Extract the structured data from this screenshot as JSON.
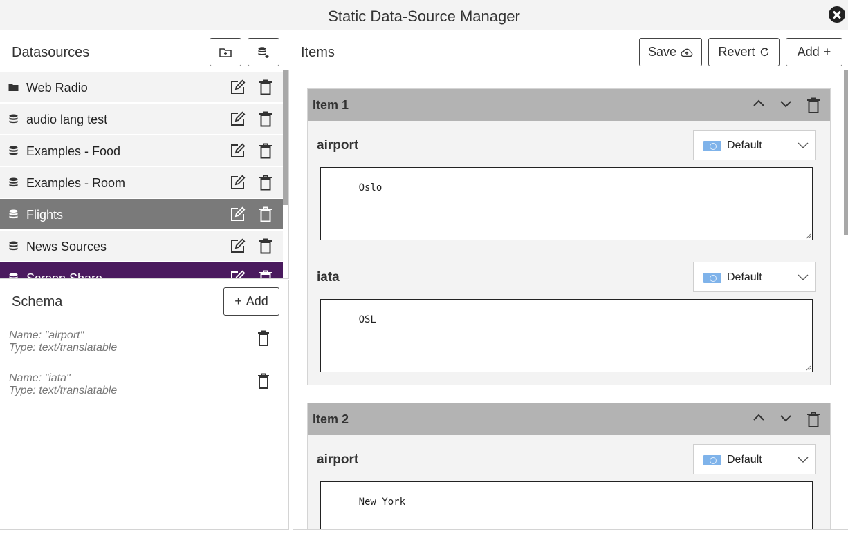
{
  "window": {
    "title": "Static Data-Source Manager"
  },
  "datasources": {
    "title": "Datasources",
    "items": [
      {
        "label": "Web Radio",
        "icon": "folder-icon",
        "state": "normal"
      },
      {
        "label": "audio lang test",
        "icon": "database-icon",
        "state": "normal"
      },
      {
        "label": "Examples - Food",
        "icon": "database-icon",
        "state": "normal"
      },
      {
        "label": "Examples - Room",
        "icon": "database-icon",
        "state": "normal"
      },
      {
        "label": "Flights",
        "icon": "database-icon",
        "state": "selected"
      },
      {
        "label": "News Sources",
        "icon": "database-icon",
        "state": "normal"
      },
      {
        "label": "Screen Share",
        "icon": "database-icon",
        "state": "highlighted"
      }
    ]
  },
  "schema": {
    "title": "Schema",
    "add_label": "Add",
    "fields": [
      {
        "name": "Name: \"airport\"",
        "type": "Type: text/translatable"
      },
      {
        "name": "Name: \"iata\"",
        "type": "Type: text/translatable"
      }
    ]
  },
  "items_panel": {
    "title": "Items",
    "save_label": "Save",
    "revert_label": "Revert",
    "add_label": "Add",
    "items": [
      {
        "title": "Item 1",
        "fields": [
          {
            "label": "airport",
            "language": "Default",
            "value": "Oslo"
          },
          {
            "label": "iata",
            "language": "Default",
            "value": "OSL"
          }
        ]
      },
      {
        "title": "Item 2",
        "fields": [
          {
            "label": "airport",
            "language": "Default",
            "value": "New York"
          }
        ]
      }
    ]
  },
  "colors": {
    "selected_row": "#7a7a7a",
    "highlighted_row": "#4a1a5e",
    "item_header": "#b3b3b3"
  }
}
